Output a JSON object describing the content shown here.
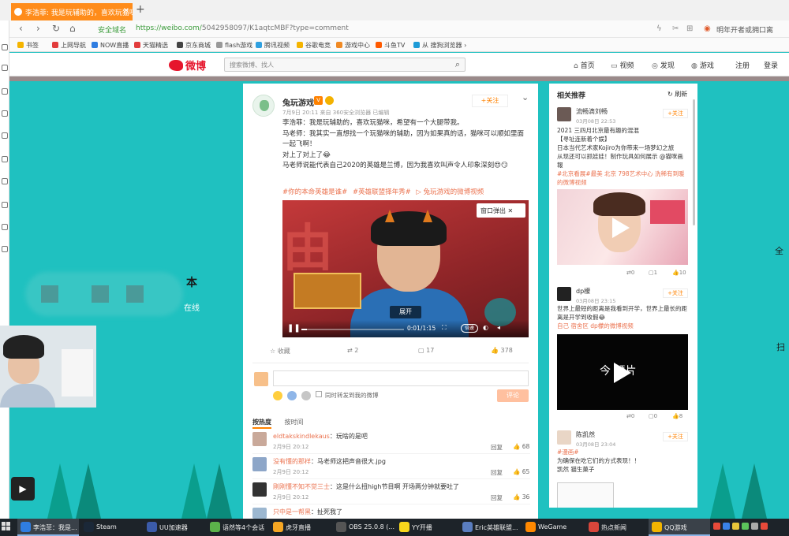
{
  "browser": {
    "tab_title": "李浩菲: 我是玩辅助的，喜欢玩猫咪",
    "tab_close": "×",
    "new_tab": "+",
    "secure_label": "安全域名",
    "url_domain": "https://weibo.com/",
    "url_path": "5042958097/K1aqtcMBF?type=comment",
    "right_hint": "明年开者或拥口离",
    "bookmarks": [
      "书签",
      "上网导航",
      "NOW直播",
      "天猫精选",
      "京东商城",
      "flash游戏",
      "腾讯视频",
      "谷歌电竞",
      "游戏中心",
      "斗鱼TV",
      "从 搜狗浏览器 ›"
    ],
    "bookmark_colors": [
      "#f5b400",
      "#e23c3c",
      "#2f7de1",
      "#e23c3c",
      "#444444",
      "#999999",
      "#2fa0e0",
      "#f5b400",
      "#f08a24",
      "#ff5a00",
      "#1e9bd7"
    ]
  },
  "weibo": {
    "logo": "微博",
    "search_placeholder": "搜索微博、找人",
    "nav": [
      "首页",
      "视频",
      "发现",
      "游戏",
      "注册",
      "登录"
    ],
    "nav_icons": [
      "home-icon",
      "video-icon",
      "compass-icon",
      "gamepad-icon",
      "",
      ""
    ]
  },
  "background": {
    "left_char": "本",
    "online": "在线",
    "right_char1": "全",
    "right_char2": "扫"
  },
  "post": {
    "author": "兔玩游戏",
    "badge": "V",
    "meta": "7月9日 20:11 来自 360安全浏览器  已编辑",
    "follow": "+关注",
    "lines": [
      "李浩菲：我是玩辅助的，喜欢玩猫咪，希望有一个大腿带我。",
      "马老师：我其实一直想找一个玩猫咪的辅助，因为如果真的话，猫咪可以顺如里面一起飞啊！",
      "对上了对上了😂",
      "马老师说能代表自己2020的英雄是兰博，因为我喜欢叫声令人印象深刻😍😏"
    ],
    "tags": [
      "#你的本命英雄是谁#",
      "#英雄联盟择年秀#",
      "兔玩游戏的微博视频"
    ],
    "video": {
      "popout": "窗口弹出",
      "expand": "展开",
      "time": "0:01/1:15",
      "speed": "倍速",
      "progress": 0.05
    },
    "actions": {
      "favorite": "收藏",
      "repost": "2",
      "comment": "17",
      "like": "378"
    },
    "repost_option": "同时转发到我的微博",
    "comment_button": "评论",
    "sort_tabs": [
      "按热度",
      "按时间"
    ],
    "comments": [
      {
        "name": "eldtakskindlekaus",
        "text": "：玩啥的是吧",
        "date": "2月9日 20:12",
        "reply": "回复",
        "likes": "68"
      },
      {
        "name": "没有懂的那样",
        "text": "：马老师这把声音很大.jpg",
        "date": "2月9日 20:12",
        "reply": "回复",
        "likes": "65"
      },
      {
        "name": "刚刚懂不知不觉三士",
        "text": "：这是什么扭high节目啊  开场两分钟就要吐了",
        "date": "2月9日 20:12",
        "reply": "回复",
        "likes": "36"
      },
      {
        "name": "只中是一帮黑",
        "text": "：扯死我了",
        "date": "",
        "reply": "",
        "likes": ""
      }
    ]
  },
  "recommend": {
    "title": "相关推荐",
    "refresh": "刷新",
    "items": [
      {
        "name": "流畅滴刘畅",
        "date": "03月08日 22:53",
        "follow": "+关注",
        "text": "2021 三四月北京最有趣的混混",
        "text2": "【寻址连新着个娱】",
        "text3": "日本当代艺术家Kojiro为你带来一场梦幻之旅",
        "text4": "从现还可以抓娃娃！制作玩具如何展示 @猫咪画報",
        "link": "#北京看展#最美  北京  798艺术中心  洗稀有到暖的微博视频",
        "stats": [
          "0",
          "1",
          "10"
        ]
      },
      {
        "name": "dp檬",
        "date": "03月08日 23:15",
        "follow": "+关注",
        "text": "世界上最短的距离是我看到开学，世界上最长的距离是开学到收假😂",
        "link": "自己 宿舍区  dp檬的微博视频",
        "video_title": "今 频片",
        "stats": [
          "0",
          "0",
          "8"
        ]
      },
      {
        "name": "陈凯然",
        "date": "03月08日 23:04",
        "follow": "+关注",
        "text": "#漫画#",
        "text2": "为确保在吃它们的方式表现！！",
        "text3": "凯然  猫生菓子"
      }
    ]
  },
  "taskbar": {
    "items": [
      "李浩菲：我是...",
      "Steam",
      "UU加速器",
      "语然等4个会话",
      "虎牙直播",
      "OBS 25.0.8 (...",
      "YY开播",
      "Eric英雄联盟...",
      "WeGame",
      "热点新闻",
      "QQ游戏"
    ],
    "colors": [
      "#2f7de1",
      "#1b2838",
      "#3b5ba9",
      "#5bb24a",
      "#f5a623",
      "#555555",
      "#f8d71c",
      "#5a7dbf",
      "#ff8800",
      "#d8463b",
      "#f2b400"
    ]
  },
  "colors": {
    "accent": "#ff8200",
    "weibo_red": "#e6162d",
    "link": "#eb7350",
    "bg_teal": "#1fc1c0"
  }
}
